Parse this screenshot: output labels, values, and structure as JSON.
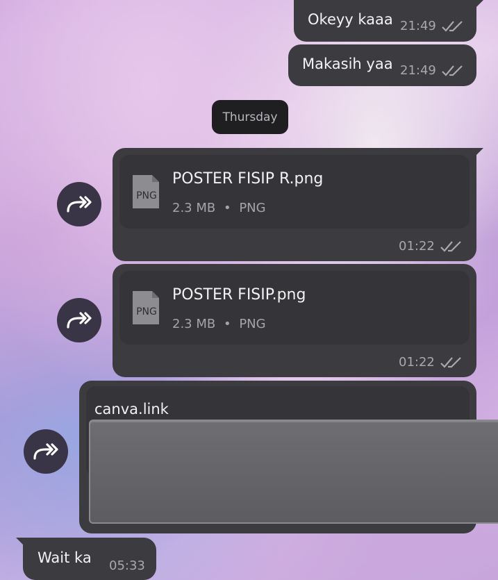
{
  "messages": {
    "m1": {
      "text": "Okeyy kaaa",
      "time": "21:49"
    },
    "m2": {
      "text": "Makasih yaa",
      "time": "21:49"
    },
    "date_separator": "Thursday",
    "file1": {
      "icon_label": "PNG",
      "name": "POSTER FISIP R.png",
      "size": "2.3 MB",
      "type": "PNG",
      "time": "01:22"
    },
    "file2": {
      "icon_label": "PNG",
      "name": "POSTER FISIP.png",
      "size": "2.3 MB",
      "type": "PNG",
      "time": "01:22"
    },
    "link": {
      "text": "canva.link"
    },
    "incoming": {
      "text": "Wait ka",
      "time": "05:33"
    }
  },
  "separator_dot": "•",
  "icons": {
    "forward": "forward-arrows-icon",
    "read": "double-check-icon",
    "file": "png-file-icon"
  },
  "colors": {
    "bubble": "#3c3b3f",
    "card": "#353438",
    "date_pill": "#1f1f22",
    "forward_button": "#3a3447"
  }
}
